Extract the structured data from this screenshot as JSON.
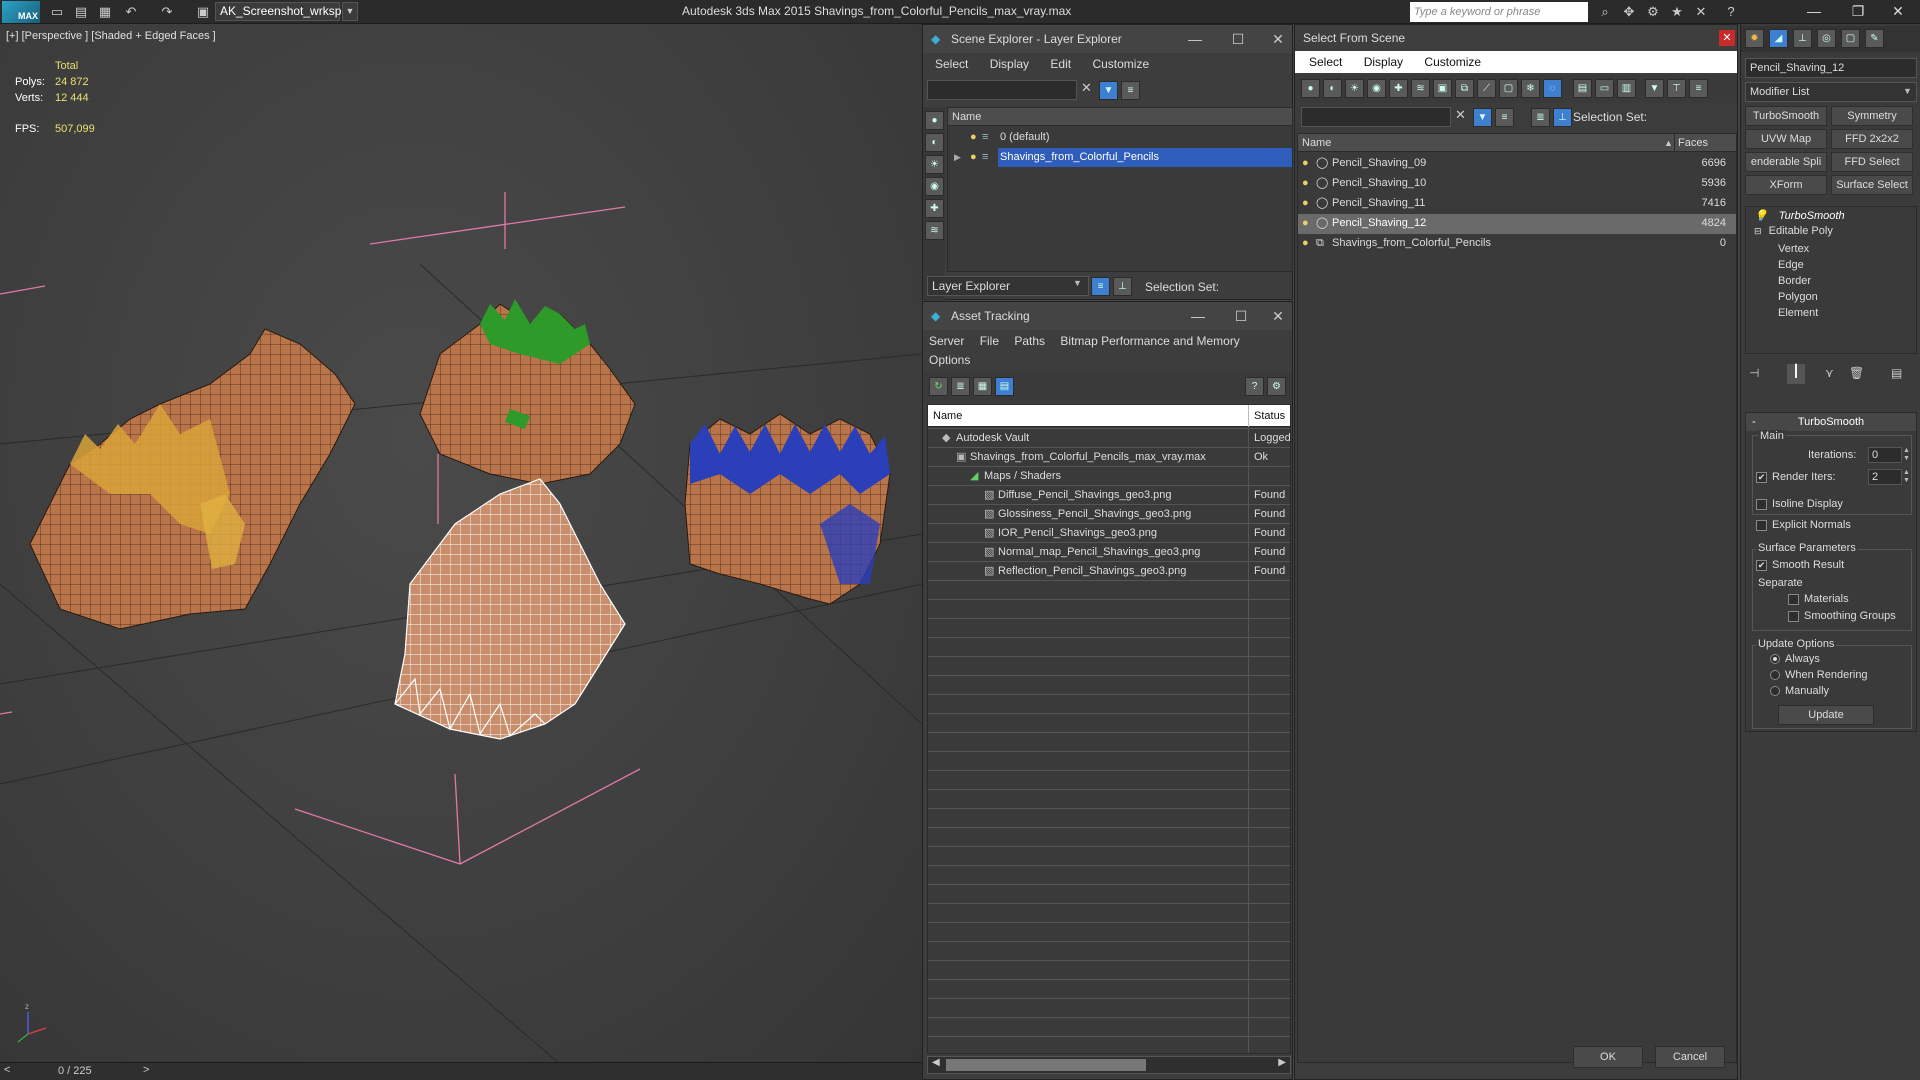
{
  "titlebar": {
    "workspace": "AK_Screenshot_wrksp",
    "app_title": "Autodesk 3ds Max  2015    Shavings_from_Colorful_Pencils_max_vray.max",
    "search_placeholder": "Type a keyword or phrase"
  },
  "viewport": {
    "label": "[+] [Perspective ] [Shaded + Edged Faces ]",
    "stats": {
      "total_label": "Total",
      "polys_label": "Polys:",
      "polys_value": "24 872",
      "verts_label": "Verts:",
      "verts_value": "12 444",
      "fps_label": "FPS:",
      "fps_value": "507,099"
    },
    "timeline_frame": "0 / 225"
  },
  "scene_explorer": {
    "title": "Scene Explorer - Layer Explorer",
    "menu": [
      "Select",
      "Display",
      "Edit",
      "Customize"
    ],
    "column_name": "Name",
    "layers": [
      {
        "name": "0 (default)",
        "selected": false
      },
      {
        "name": "Shavings_from_Colorful_Pencils",
        "selected": true
      }
    ],
    "footer_dropdown": "Layer Explorer",
    "selection_set_label": "Selection Set:"
  },
  "asset_tracking": {
    "title": "Asset Tracking",
    "menu": [
      "Server",
      "File",
      "Paths",
      "Bitmap Performance and Memory"
    ],
    "menu2": [
      "Options"
    ],
    "col_name": "Name",
    "col_status": "Status",
    "rows": [
      {
        "name": "Autodesk Vault",
        "status": "Logged",
        "indent": 1
      },
      {
        "name": "Shavings_from_Colorful_Pencils_max_vray.max",
        "status": "Ok",
        "indent": 2
      },
      {
        "name": "Maps / Shaders",
        "status": "",
        "indent": 3
      },
      {
        "name": "Diffuse_Pencil_Shavings_geo3.png",
        "status": "Found",
        "indent": 4
      },
      {
        "name": "Glossiness_Pencil_Shavings_geo3.png",
        "status": "Found",
        "indent": 4
      },
      {
        "name": "IOR_Pencil_Shavings_geo3.png",
        "status": "Found",
        "indent": 4
      },
      {
        "name": "Normal_map_Pencil_Shavings_geo3.png",
        "status": "Found",
        "indent": 4
      },
      {
        "name": "Reflection_Pencil_Shavings_geo3.png",
        "status": "Found",
        "indent": 4
      }
    ]
  },
  "select_from_scene": {
    "title": "Select From Scene",
    "menu": [
      "Select",
      "Display",
      "Customize"
    ],
    "selection_set_label": "Selection Set:",
    "col_name": "Name",
    "col_faces": "Faces",
    "rows": [
      {
        "name": "Pencil_Shaving_09",
        "faces": "6696",
        "selected": false
      },
      {
        "name": "Pencil_Shaving_10",
        "faces": "5936",
        "selected": false
      },
      {
        "name": "Pencil_Shaving_11",
        "faces": "7416",
        "selected": false
      },
      {
        "name": "Pencil_Shaving_12",
        "faces": "4824",
        "selected": true
      },
      {
        "name": "Shavings_from_Colorful_Pencils",
        "faces": "0",
        "selected": false
      }
    ],
    "ok": "OK",
    "cancel": "Cancel"
  },
  "modify_panel": {
    "object_name": "Pencil_Shaving_12",
    "modifier_list": "Modifier List",
    "buttons": [
      "TurboSmooth",
      "Symmetry",
      "UVW Map",
      "FFD 2x2x2",
      "enderable Spli",
      "FFD Select",
      "XForm",
      "Surface Select"
    ],
    "stack": {
      "top": "TurboSmooth",
      "base": "Editable Poly",
      "subs": [
        "Vertex",
        "Edge",
        "Border",
        "Polygon",
        "Element"
      ]
    },
    "turbosmooth": {
      "title": "TurboSmooth",
      "main": "Main",
      "iterations_label": "Iterations:",
      "iterations_value": "0",
      "render_iters_label": "Render Iters:",
      "render_iters_value": "2",
      "isoline": "Isoline Display",
      "explicit": "Explicit Normals",
      "surface_params": "Surface Parameters",
      "smooth_result": "Smooth Result",
      "separate": "Separate",
      "materials": "Materials",
      "smoothing_groups": "Smoothing Groups",
      "update_options": "Update Options",
      "always": "Always",
      "when_rendering": "When Rendering",
      "manually": "Manually",
      "update": "Update"
    }
  }
}
